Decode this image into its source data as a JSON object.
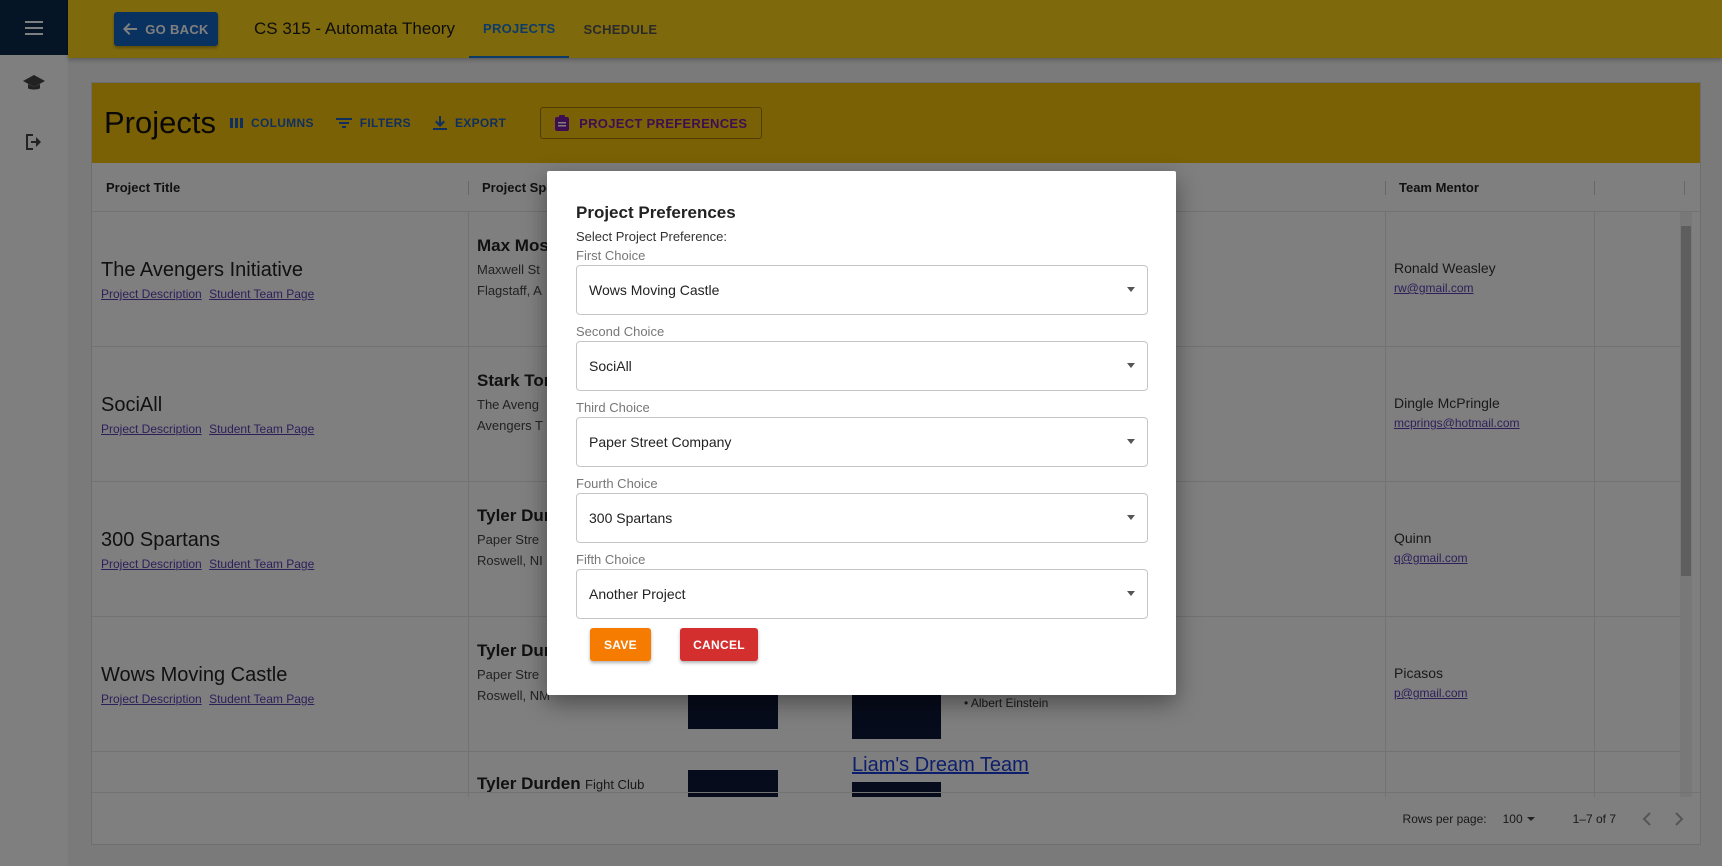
{
  "header": {
    "back_label": "GO BACK",
    "course_title": "CS 315 - Automata Theory",
    "tabs": [
      {
        "label": "PROJECTS",
        "active": true
      },
      {
        "label": "SCHEDULE",
        "active": false
      }
    ]
  },
  "toolbar": {
    "title": "Projects",
    "columns_label": "COLUMNS",
    "filters_label": "FILTERS",
    "export_label": "EXPORT",
    "preferences_label": "PROJECT PREFERENCES"
  },
  "columns": {
    "project_title": "Project Title",
    "project_sponsor": "Project Spo",
    "team_mentor": "Team Mentor"
  },
  "rows": [
    {
      "title": "The Avengers Initiative",
      "desc_link": "Project Description",
      "team_link": "Student Team Page",
      "sponsor_name": "Max Mos",
      "sponsor_line1": "Maxwell St",
      "sponsor_line2": "Flagstaff, A",
      "mentor": "Ronald Weasley",
      "mentor_email": "rw@gmail.com"
    },
    {
      "title": "SociAll",
      "desc_link": "Project Description",
      "team_link": "Student Team Page",
      "sponsor_name": "Stark Tor",
      "sponsor_line1": "The Aveng",
      "sponsor_line2": "Avengers T",
      "mentor": "Dingle McPringle",
      "mentor_email": "mcprings@hotmail.com"
    },
    {
      "title": "300 Spartans",
      "desc_link": "Project Description",
      "team_link": "Student Team Page",
      "sponsor_name": "Tyler Dur",
      "sponsor_line1": "Paper Stre",
      "sponsor_line2": "Roswell, NI",
      "mentor": "Quinn",
      "mentor_email": "q@gmail.com"
    },
    {
      "title": "Wows Moving Castle",
      "desc_link": "Project Description",
      "team_link": "Student Team Page",
      "sponsor_name": "Tyler Dur",
      "sponsor_line1": "Paper Stre",
      "sponsor_line2": "Roswell, NM",
      "mentor": "Picasos",
      "mentor_email": "p@gmail.com",
      "student": "Albert Einstein"
    },
    {
      "sponsor_name": "Tyler Durden",
      "sponsor_company": "Fight Club",
      "team_link_big": "Liam's Dream Team"
    }
  ],
  "footer": {
    "rows_per_page_label": "Rows per page:",
    "rows_per_page_value": "100",
    "range": "1–7 of 7"
  },
  "modal": {
    "title": "Project Preferences",
    "subtitle": "Select Project Preference:",
    "choices": [
      {
        "label": "First Choice",
        "value": "Wows Moving Castle"
      },
      {
        "label": "Second Choice",
        "value": "SociAll"
      },
      {
        "label": "Third Choice",
        "value": "Paper Street Company"
      },
      {
        "label": "Fourth Choice",
        "value": "300 Spartans"
      },
      {
        "label": "Fifth Choice",
        "value": "Another Project"
      }
    ],
    "save_label": "SAVE",
    "cancel_label": "CANCEL"
  },
  "colors": {
    "header_yellow": "#ffd31a",
    "toolbar_yellow": "#f7c20a",
    "nav_navy": "#0c2a4d",
    "primary_blue": "#1565c0",
    "save_orange": "#f57c00",
    "cancel_red": "#d32f2f"
  }
}
